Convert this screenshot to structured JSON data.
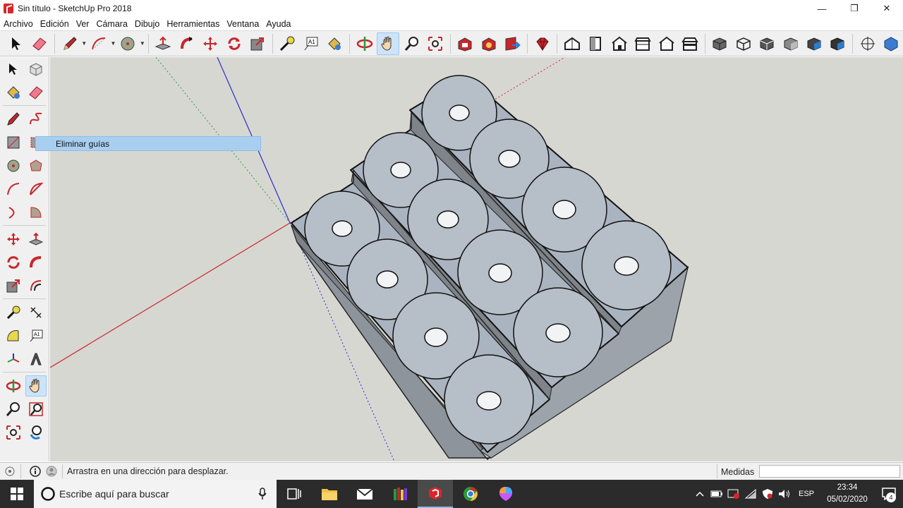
{
  "window": {
    "title": "Sin título - SketchUp Pro 2018",
    "minimize_glyph": "—",
    "maximize_glyph": "❐",
    "close_glyph": "✕"
  },
  "menu": [
    "Archivo",
    "Edición",
    "Ver",
    "Cámara",
    "Dibujo",
    "Herramientas",
    "Ventana",
    "Ayuda"
  ],
  "toolbar": {
    "icons": [
      "select-icon",
      "eraser-icon",
      "pencil-icon",
      "arc-icon",
      "circle-icon",
      "push-pull-icon",
      "follow-me-icon",
      "move-icon",
      "rotate-icon",
      "scale-icon",
      "tape-measure-icon",
      "text-icon",
      "paint-bucket-icon",
      "orbit-icon",
      "pan-icon",
      "zoom-icon",
      "zoom-extents-icon",
      "warehouse-icon",
      "extension-warehouse-icon",
      "share-model-icon",
      "ruby-icon",
      "iso-view-icon",
      "top-view-icon",
      "front-view-icon",
      "right-view-icon",
      "back-view-icon",
      "left-view-icon",
      "xray-icon",
      "wireframe-icon",
      "hidden-line-icon",
      "shaded-icon",
      "textured-icon",
      "monochrome-icon",
      "axes-icon",
      "style-icon"
    ],
    "active": "pan-icon"
  },
  "palette": {
    "active": "pan-icon"
  },
  "flyout": {
    "label": "Eliminar guías"
  },
  "status": {
    "message": "Arrastra en una dirección para desplazar.",
    "measures_label": "Medidas",
    "measures_value": ""
  },
  "taskbar": {
    "search_placeholder": "Escribe aquí para buscar",
    "language": "ESP",
    "time": "23:34",
    "date": "05/02/2020",
    "notifications": "4"
  },
  "colors": {
    "viewport_bg": "#d7d7d2",
    "model_face": "#aab4c0",
    "model_side": "#8b8f95",
    "axis_red": "#c8262b",
    "axis_green": "#2a9a3a",
    "axis_blue": "#2a2ad0",
    "selection_blue": "#cde3f7"
  }
}
